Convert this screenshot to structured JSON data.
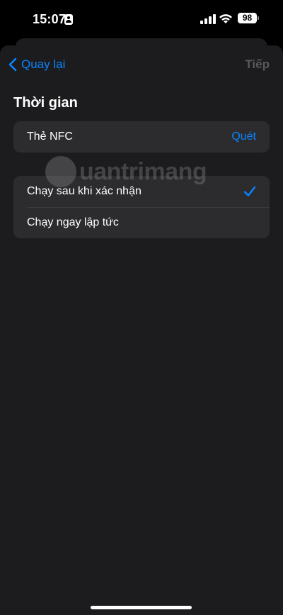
{
  "status_bar": {
    "time": "15:07",
    "battery": "98"
  },
  "nav": {
    "back_label": "Quay lại",
    "next_label": "Tiếp"
  },
  "section": {
    "title": "Thời gian"
  },
  "nfc_row": {
    "label": "Thẻ NFC",
    "action": "Quét"
  },
  "options": [
    {
      "label": "Chạy sau khi xác nhận",
      "selected": true
    },
    {
      "label": "Chạy ngay lập tức",
      "selected": false
    }
  ],
  "watermark": {
    "text": "uantrimang"
  },
  "colors": {
    "accent": "#0a84ff",
    "background": "#1c1c1e",
    "cell": "#2c2c2e",
    "disabled": "#5a5a5e"
  }
}
